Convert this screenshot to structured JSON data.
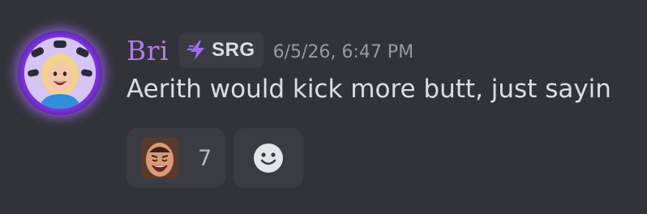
{
  "message": {
    "author": {
      "name": "Bri",
      "name_color": "#b57be6",
      "avatar_icon": "avatar-photo-icon",
      "avatar_ring_color": "#8a3ff0"
    },
    "guild_tag": {
      "icon": "lightning-bolt-icon",
      "icon_color": "#a06cf0",
      "label": "SRG"
    },
    "timestamp": "6/5/26, 6:47 PM",
    "content": "Aerith would kick more butt, just sayin",
    "reactions": [
      {
        "emoji": "laughing-face-emoji-icon",
        "count": "7"
      }
    ],
    "add_reaction_icon": "smile-icon"
  },
  "colors": {
    "background": "#313338",
    "chip_background": "#3a3c42",
    "text": "#dbdee1",
    "muted_text": "#949ba4"
  }
}
